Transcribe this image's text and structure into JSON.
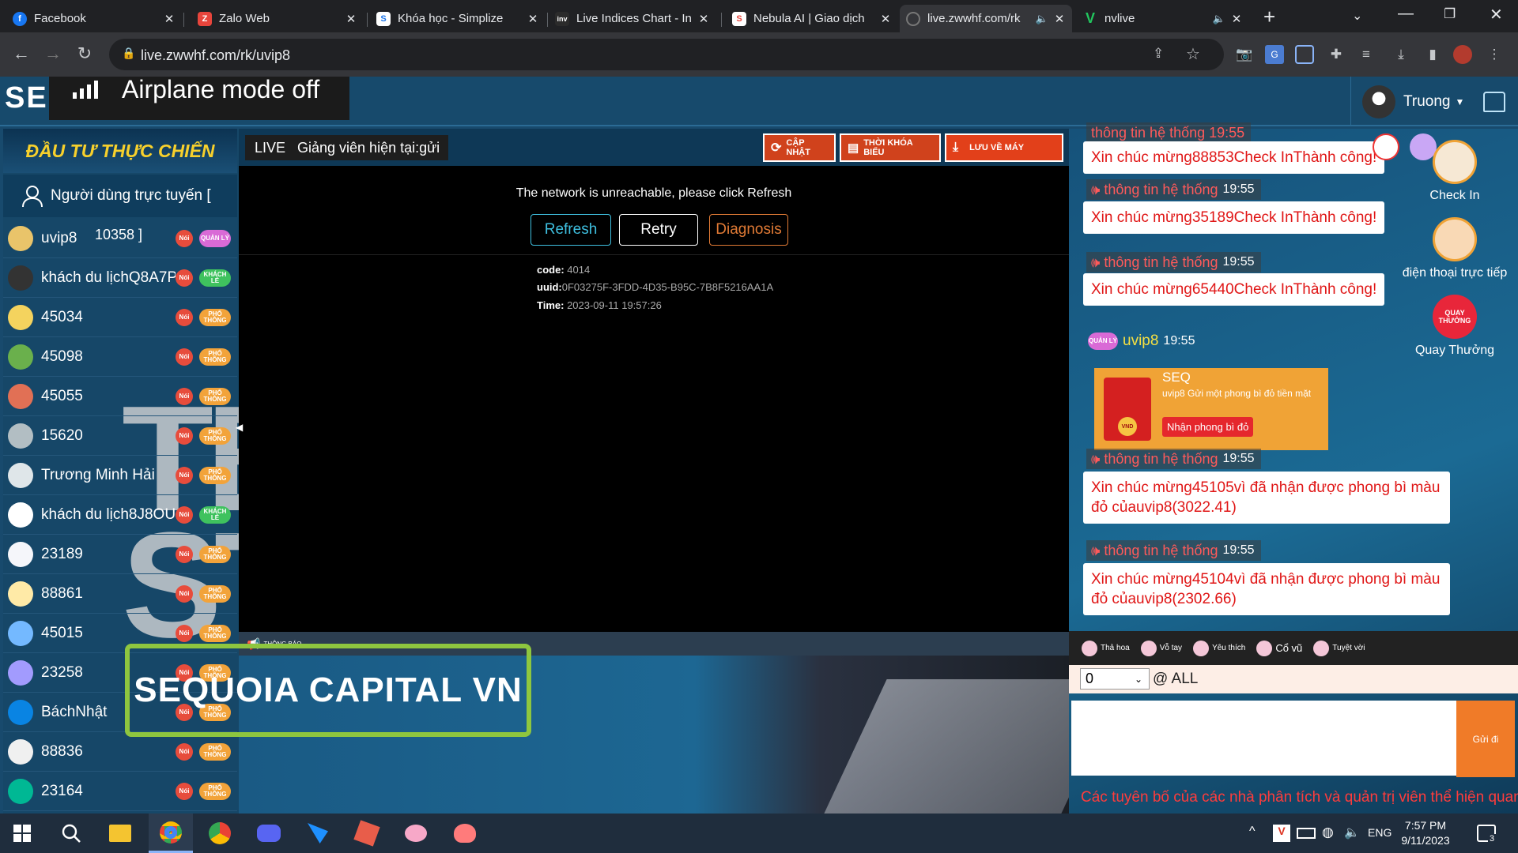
{
  "browser": {
    "tabs": [
      {
        "title": "Facebook",
        "favicon": "facebook-icon",
        "color": "#1877f2"
      },
      {
        "title": "Zalo Web",
        "favicon": "zalo-icon",
        "color": "#e8453c"
      },
      {
        "title": "Khóa học - Simplize",
        "favicon": "simplize-icon",
        "color": "#ffffff"
      },
      {
        "title": "Live Indices Chart - In",
        "favicon": "investing-icon",
        "color": "#2b2b2b"
      },
      {
        "title": "Nebula AI | Giao dịch",
        "favicon": "nebula-icon",
        "color": "#ffffff"
      },
      {
        "title": "live.zwwhf.com/rk",
        "favicon": "loading-icon",
        "color": "#777777"
      },
      {
        "title": "nvlive",
        "favicon": "nvlive-icon",
        "color": "#22c55e"
      }
    ],
    "url": "live.zwwhf.com/rk/uvip8"
  },
  "header": {
    "logo_text": "SEQ",
    "toast": "Airplane mode off",
    "username": "Truong"
  },
  "left": {
    "banner": "ĐẦU TƯ THỰC CHIẾN",
    "online_label": "Người dùng trực tuyến [",
    "online_count": "10358 ]",
    "watermark": "TB ST",
    "badges": {
      "noi": "Nói",
      "pho_thong": "PHỔ THÔNG",
      "quan_ly": "QUẢN LÝ",
      "khach_le": "KHÁCH LẺ"
    },
    "users": [
      {
        "name": "uvip8",
        "badge": "ql",
        "avatar": "#e9c46a"
      },
      {
        "name": "khách du lịchQ8A7PI",
        "badge": "kl",
        "avatar": "#333333"
      },
      {
        "name": "45034",
        "badge": "pt",
        "avatar": "#f4d35e"
      },
      {
        "name": "45098",
        "badge": "pt",
        "avatar": "#6ab04c"
      },
      {
        "name": "45055",
        "badge": "pt",
        "avatar": "#e17055"
      },
      {
        "name": "15620",
        "badge": "pt",
        "avatar": "#b2bec3"
      },
      {
        "name": "Trương Minh Hải",
        "badge": "pt",
        "avatar": "#dfe6e9"
      },
      {
        "name": "khách du lịch8J8OU",
        "badge": "kl",
        "avatar": "#ffffff"
      },
      {
        "name": "23189",
        "badge": "pt",
        "avatar": "#f5f6fa"
      },
      {
        "name": "88861",
        "badge": "pt",
        "avatar": "#ffeaa7"
      },
      {
        "name": "45015",
        "badge": "pt",
        "avatar": "#74b9ff"
      },
      {
        "name": "23258",
        "badge": "pt",
        "avatar": "#a29bfe"
      },
      {
        "name": "BáchNhật",
        "badge": "pt",
        "avatar": "#0984e3"
      },
      {
        "name": "88836",
        "badge": "pt",
        "avatar": "#f0f0f0"
      },
      {
        "name": "23164",
        "badge": "pt",
        "avatar": "#00b894"
      }
    ]
  },
  "center": {
    "live_tag": "LIVE",
    "lecturer": "Giảng viên hiện tại:gửi",
    "buttons": {
      "update": "CẬP NHẬT",
      "schedule": "THỜI KHÓA BIỂU",
      "save": "LƯU VỀ MÁY"
    },
    "network_message": "The network is unreachable, please click Refresh",
    "refresh": "Refresh",
    "retry": "Retry",
    "diagnosis": "Diagnosis",
    "error": {
      "code_label": "code:",
      "code": "4014",
      "uuid_label": "uuid:",
      "uuid": "0F03275F-3FDD-4D35-B95C-7B8F5216AA1A",
      "time_label": "Time:",
      "time": "2023-09-11 19:57:26"
    },
    "notice_label": "THÔNG BÁO",
    "brand_banner": "SEQUOIA CAPITAL VN"
  },
  "chat": {
    "top_partial": "thông tin hệ thống 19:55",
    "system_label": "thông tin hệ thống",
    "messages": [
      {
        "text": "Xin chúc mừng88853Check InThành công!"
      },
      {
        "time": "19:55",
        "text": "Xin chúc mừng35189Check InThành công!"
      },
      {
        "time": "19:55",
        "text": "Xin chúc mừng65440Check InThành công!"
      }
    ],
    "packet": {
      "badge": "QUẢN LÝ",
      "user": "uvip8",
      "time": "19:55",
      "title": "SEQ",
      "desc": "uvip8 Gửi một phong bì đỏ tiền mặt",
      "button": "Nhận phong bì đỏ",
      "currency": "VND"
    },
    "messages2": [
      {
        "time": "19:55",
        "text": "Xin chúc mừng45105vì đã nhận được phong bì màu đỏ củauvip8(3022.41)"
      },
      {
        "time": "19:55",
        "text": "Xin chúc mừng45104vì đã nhận được phong bì màu đỏ củauvip8(2302.66)"
      }
    ],
    "side": {
      "checkin": "Check In",
      "phone": "điện thoại trực tiếp",
      "wheel": "Quay Thưởng",
      "wheel_badge": "QUAY THƯỞNG"
    },
    "emojis": [
      "Thả hoa",
      "Vỗ tay",
      "Yêu thích",
      "Cổ vũ",
      "Tuyệt vời"
    ],
    "recipient": "0",
    "at_all": "@ ALL",
    "send": "Gửi đi",
    "marquee": "Các tuyên bố của các nhà phân tích và quản trị viên thể hiện quan"
  },
  "taskbar": {
    "lang": "ENG",
    "time": "7:57 PM",
    "date": "9/11/2023",
    "notifications": "3"
  }
}
